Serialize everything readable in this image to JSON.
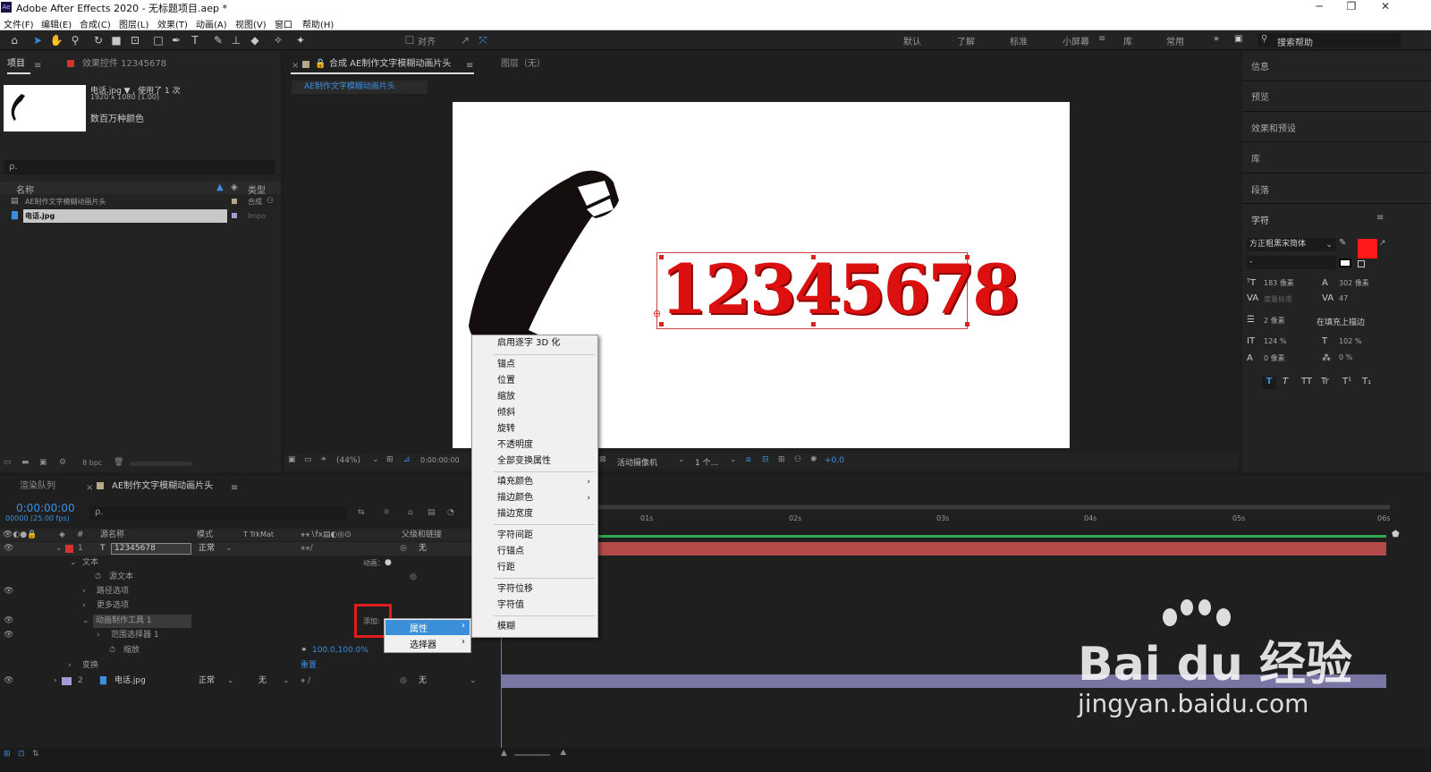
{
  "title_bar": {
    "app_icon": "Ae",
    "title": "Adobe After Effects 2020 - 无标题项目.aep *",
    "minimize": "─",
    "restore": "❐",
    "close": "✕"
  },
  "menu": [
    "文件(F)",
    "编辑(E)",
    "合成(C)",
    "图层(L)",
    "效果(T)",
    "动画(A)",
    "视图(V)",
    "窗口",
    "帮助(H)"
  ],
  "toolbar": {
    "align_label": "对齐",
    "workspaces": [
      "默认",
      "了解",
      "标准",
      "小屏幕",
      "库",
      "常用"
    ],
    "active_workspace": "小屏幕",
    "more": "»",
    "search_placeholder": "搜索帮助"
  },
  "project_panel": {
    "tab_project": "项目",
    "tab_effects": "效果控件 12345678",
    "asset_name": "电话.jpg ▼ , 使用了 1 次",
    "asset_dims": "1920 x 1080 (1.00)",
    "asset_colors": "数百万种颜色",
    "search_placeholder": "ρ.",
    "col_name": "名称",
    "col_type": "类型",
    "items": [
      {
        "name": "AE制作文字模糊动画片头",
        "type": "合成"
      },
      {
        "name": "电话.jpg",
        "type": "Impo"
      }
    ],
    "bpc": "8 bpc"
  },
  "composition_panel": {
    "tab": "合成 AE制作文字模糊动画片头",
    "layer_tab": "图层（无）",
    "subtab": "AE制作文字模糊动画片头",
    "canvas_text": "12345678",
    "zoom": "(44%)",
    "timecode": "0:00:00:00",
    "camera": "活动摄像机",
    "views": "1 个...",
    "exposure": "+0.0"
  },
  "context_menu": {
    "items": [
      {
        "label": "启用逐字 3D 化",
        "sep_after": true
      },
      {
        "label": "锚点"
      },
      {
        "label": "位置"
      },
      {
        "label": "缩放"
      },
      {
        "label": "倾斜"
      },
      {
        "label": "旋转"
      },
      {
        "label": "不透明度"
      },
      {
        "label": "全部变换属性",
        "sep_after": true
      },
      {
        "label": "填充颜色",
        "submenu": true
      },
      {
        "label": "描边颜色",
        "submenu": true
      },
      {
        "label": "描边宽度",
        "sep_after": true
      },
      {
        "label": "字符间距"
      },
      {
        "label": "行锚点"
      },
      {
        "label": "行距",
        "sep_after": true
      },
      {
        "label": "字符位移"
      },
      {
        "label": "字符值",
        "sep_after": true
      },
      {
        "label": "模糊"
      }
    ]
  },
  "submenu": {
    "items": [
      "属性",
      "选择器"
    ],
    "active": "属性"
  },
  "right_panel": {
    "items": [
      "信息",
      "预览",
      "效果和预设",
      "库",
      "段落"
    ],
    "character_title": "字符",
    "font": "方正粗黑宋简体",
    "style": "-",
    "font_size": "183 像素",
    "leading": "302 像素",
    "kerning": "度量标准",
    "tracking": "47",
    "stroke": "2 像素",
    "stroke_mode": "在填充上描边",
    "vscale": "124 %",
    "hscale": "102 %",
    "baseline": "0 像素",
    "tsume": "0 %",
    "fill_color": "#ff1a1a",
    "styles": [
      "T",
      "T",
      "TT",
      "Tr",
      "T¹",
      "T₁"
    ]
  },
  "timeline": {
    "tab_render": "渲染队列",
    "tab_comp": "AE制作文字模糊动画片头",
    "timecode": "0:00:00:00",
    "fps": "00000 (25.00 fps)",
    "search_placeholder": "ρ.",
    "col_source": "源名称",
    "col_mode": "模式",
    "col_trkmat": "T  TrkMat",
    "col_parent": "父级和链接",
    "ruler": [
      "01s",
      "02s",
      "03s",
      "04s",
      "05s",
      "06s"
    ],
    "layer1": {
      "num": "1",
      "name": "12345678",
      "mode": "正常",
      "parent": "无"
    },
    "text_group": "文本",
    "animate_label": "动画：",
    "source_text": "源文本",
    "path_options": "路径选项",
    "more_options": "更多选项",
    "animator": "动画制作工具 1",
    "add_label": "添加:",
    "range_selector": "范围选择器 1",
    "scale": "缩放",
    "scale_value": "100.0,100.0%",
    "transform": "变换",
    "reset": "重置",
    "layer2": {
      "num": "2",
      "name": "电话.jpg",
      "mode": "正常",
      "trkmat": "无",
      "parent": "无"
    }
  },
  "watermark": {
    "brand": "Bai du 经验",
    "url": "jingyan.baidu.com"
  }
}
